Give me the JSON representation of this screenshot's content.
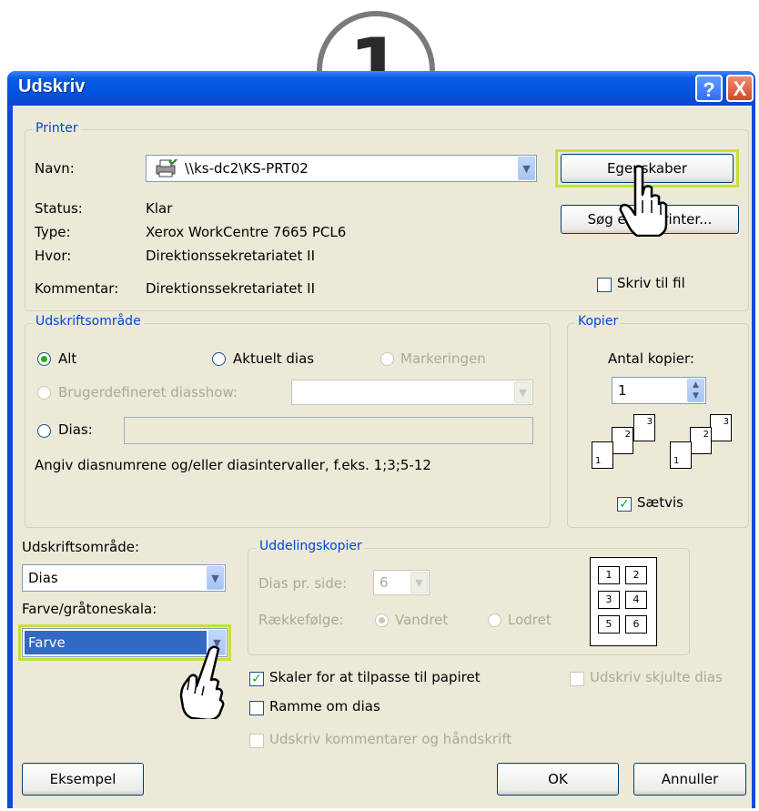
{
  "step_badge": "1",
  "window": {
    "title": "Udskriv",
    "help_glyph": "?",
    "close_glyph": "X"
  },
  "printer": {
    "legend": "Printer",
    "name_label": "Navn:",
    "name_value": "\\\\ks-dc2\\KS-PRT02",
    "status_label": "Status:",
    "status_value": "Klar",
    "type_label": "Type:",
    "type_value": "Xerox WorkCentre 7665 PCL6",
    "where_label": "Hvor:",
    "where_value": "Direktionssekretariatet II",
    "comment_label": "Kommentar:",
    "comment_value": "Direktionssekretariatet II",
    "properties_button": "Egenskaber",
    "find_printer_button": "Søg efter printer...",
    "print_to_file_label": "Skriv til fil",
    "print_to_file_checked": false
  },
  "print_range": {
    "legend": "Udskriftsområde",
    "all_label": "Alt",
    "current_slide_label": "Aktuelt dias",
    "selection_label": "Markeringen",
    "custom_show_label": "Brugerdefineret diasshow:",
    "slides_label": "Dias:",
    "slides_value": "",
    "hint": "Angiv diasnumrene og/eller diasintervaller, f.eks. 1;3;5-12",
    "selected": "all"
  },
  "copies": {
    "legend": "Kopier",
    "count_label": "Antal kopier:",
    "count_value": "1",
    "collate_label": "Sætvis",
    "collate_checked": true,
    "page_numbers": [
      "1",
      "2",
      "3"
    ]
  },
  "print_what": {
    "label": "Udskriftsområde:",
    "value": "Dias"
  },
  "color": {
    "label": "Farve/gråtoneskala:",
    "value": "Farve"
  },
  "handouts": {
    "legend": "Uddelingskopier",
    "slides_per_page_label": "Dias pr. side:",
    "slides_per_page_value": "6",
    "order_label": "Rækkefølge:",
    "horizontal_label": "Vandret",
    "vertical_label": "Lodret",
    "layout_numbers": [
      "1",
      "2",
      "3",
      "4",
      "5",
      "6"
    ]
  },
  "options": {
    "scale_to_fit_label": "Skaler for at tilpasse til papiret",
    "scale_to_fit_checked": true,
    "frame_slides_label": "Ramme om dias",
    "frame_slides_checked": false,
    "comments_label": "Udskriv kommentarer og håndskrift",
    "hidden_slides_label": "Udskriv skjulte dias"
  },
  "footer": {
    "preview_button": "Eksempel",
    "ok_button": "OK",
    "cancel_button": "Annuller"
  },
  "colors": {
    "titlebar": "#0a5ce8",
    "face": "#ece9d8",
    "accent": "#0046d5",
    "highlight": "#c5e03a",
    "selection": "#316ac5"
  }
}
